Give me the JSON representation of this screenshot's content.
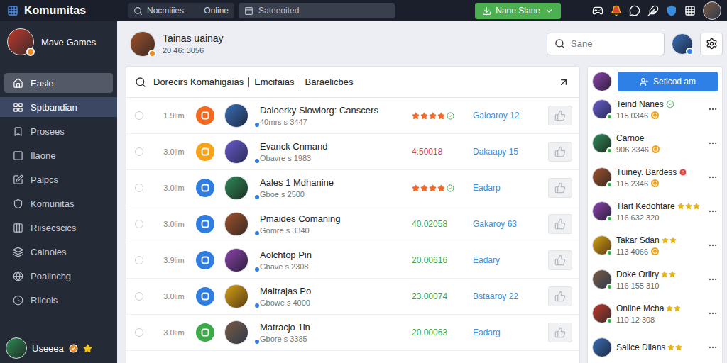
{
  "app": {
    "title": "Komumitas"
  },
  "topbar": {
    "search": {
      "value": "Nocmiiies"
    },
    "status": "Online",
    "selector": {
      "value": "Sateeoited"
    },
    "primary_button": {
      "label": "Nane Slane"
    }
  },
  "sidebar": {
    "profile": {
      "name": "Mave Games"
    },
    "items": [
      {
        "label": "Easle",
        "selected": false,
        "highlighted": true
      },
      {
        "label": "Sptbandian",
        "selected": true,
        "highlighted": false
      },
      {
        "label": "Prosees",
        "selected": false,
        "highlighted": false
      },
      {
        "label": "Ilaone",
        "selected": false,
        "highlighted": false
      },
      {
        "label": "Palpcs",
        "selected": false,
        "highlighted": false
      },
      {
        "label": "Komunitas",
        "selected": false,
        "highlighted": false
      },
      {
        "label": "Riisecscics",
        "selected": false,
        "highlighted": false
      },
      {
        "label": "Calnoies",
        "selected": false,
        "highlighted": false
      },
      {
        "label": "Poalinchg",
        "selected": false,
        "highlighted": false
      },
      {
        "label": "Riicols",
        "selected": false,
        "highlighted": false
      }
    ],
    "user": {
      "name": "Useeea"
    }
  },
  "header": {
    "title": "Tainas uainay",
    "subtitle": "20 46: 3056",
    "search": {
      "placeholder": "Sane"
    }
  },
  "table": {
    "filters": [
      "Dorecirs Komahigaias",
      "Emcifaias",
      "Baraelicbes"
    ],
    "rows": [
      {
        "checked": false,
        "time": "1.9lim",
        "color": "#f26a21",
        "name": "Daloerky Slowiorg: Canscers",
        "detail": "40mrs s 3447",
        "kind": "stars",
        "stars": 4,
        "link": "Galoaroy 12"
      },
      {
        "checked": false,
        "time": "3.0lim",
        "color": "#f5a31a",
        "name": "Evanck Cnmand",
        "detail": "Obavre s 1983",
        "kind": "value",
        "value": "4:50018",
        "tone": "negative",
        "link": "Dakaapy 15"
      },
      {
        "checked": false,
        "time": "3.0lim",
        "color": "#2f7de1",
        "name": "Aales 1 Mdhanine",
        "detail": "Gboe s 2500",
        "kind": "stars",
        "stars": 4,
        "link": "Eadarp"
      },
      {
        "checked": false,
        "time": "3.0lim",
        "color": "#2f7de1",
        "name": "Pmaides Comaning",
        "detail": "Gomre s 3340",
        "kind": "value",
        "value": "40.02058",
        "tone": "positive",
        "link": "Gakaroy 63"
      },
      {
        "checked": false,
        "time": "3.9lim",
        "color": "#2f7de1",
        "name": "Aolchtop Pin",
        "detail": "Gbave s 2308",
        "kind": "value",
        "value": "20.00616",
        "tone": "positive",
        "link": "Eadary"
      },
      {
        "checked": false,
        "time": "3.0lim",
        "color": "#2f7de1",
        "name": "Maitrajas Po",
        "detail": "Gbowe s 4000",
        "kind": "value",
        "value": "23.00074",
        "tone": "positive",
        "link": "Bstaaroy 22"
      },
      {
        "checked": false,
        "time": "3.0lim",
        "color": "#3daa4a",
        "name": "Matracjo 1in",
        "detail": "Gbore s 3385",
        "kind": "value",
        "value": "20.00063",
        "tone": "positive",
        "link": "Eadarg"
      }
    ]
  },
  "friends": {
    "button": "Seticod am",
    "items": [
      {
        "name": "Teind Nanes",
        "meta": "115 0346",
        "badge": "verified",
        "coin": true,
        "online": true
      },
      {
        "name": "Carnoe",
        "meta": "906 3346",
        "badge": "none",
        "coin": true,
        "online": true
      },
      {
        "name": "Tuiney. Bardess",
        "meta": "115 2346",
        "badge": "alert",
        "coin": true,
        "online": true
      },
      {
        "name": "Tlart Kedohtare",
        "meta": "116 632 320",
        "badge": "stars",
        "stars": 3,
        "coin": false,
        "online": true
      },
      {
        "name": "Takar Sdan",
        "meta": "113 4066",
        "badge": "stars",
        "stars": 2,
        "coin": true,
        "online": true
      },
      {
        "name": "Doke Orliry",
        "meta": "116 155 310",
        "badge": "stars",
        "stars": 2,
        "coin": false,
        "online": true
      },
      {
        "name": "Online Mcha",
        "meta": "110 12 308",
        "badge": "stars",
        "stars": 2,
        "coin": false,
        "online": true
      },
      {
        "name": "Saiice Diians",
        "badge": "stars",
        "stars": 2,
        "coin": false,
        "online": false
      }
    ]
  }
}
